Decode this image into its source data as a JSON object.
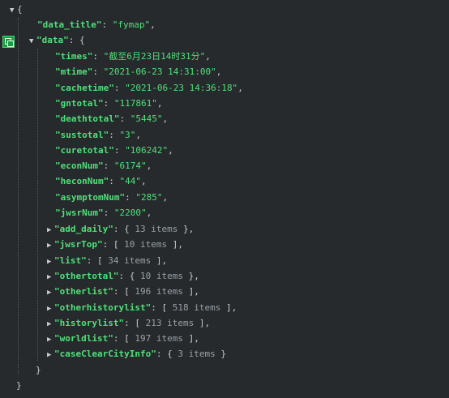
{
  "root": {
    "open": "{",
    "close": "}",
    "toggle": "▼"
  },
  "data_title": {
    "key": "\"data_title\"",
    "value": "\"fymap\""
  },
  "data_obj": {
    "key": "\"data\"",
    "open": "{",
    "close": "}",
    "toggle": "▼"
  },
  "fields": [
    {
      "key": "\"times\"",
      "value": "\"截至6月23日14时31分\""
    },
    {
      "key": "\"mtime\"",
      "value": "\"2021-06-23 14:31:00\""
    },
    {
      "key": "\"cachetime\"",
      "value": "\"2021-06-23 14:36:18\""
    },
    {
      "key": "\"gntotal\"",
      "value": "\"117861\""
    },
    {
      "key": "\"deathtotal\"",
      "value": "\"5445\""
    },
    {
      "key": "\"sustotal\"",
      "value": "\"3\""
    },
    {
      "key": "\"curetotal\"",
      "value": "\"106242\""
    },
    {
      "key": "\"econNum\"",
      "value": "\"6174\""
    },
    {
      "key": "\"heconNum\"",
      "value": "\"44\""
    },
    {
      "key": "\"asymptomNum\"",
      "value": "\"285\""
    },
    {
      "key": "\"jwsrNum\"",
      "value": "\"2200\""
    }
  ],
  "collapsed": [
    {
      "key": "\"add_daily\"",
      "open": "{",
      "count": "13 items",
      "close": "}",
      "toggle": "▶"
    },
    {
      "key": "\"jwsrTop\"",
      "open": "[",
      "count": "10 items",
      "close": "]",
      "toggle": "▶"
    },
    {
      "key": "\"list\"",
      "open": "[",
      "count": "34 items",
      "close": "]",
      "toggle": "▶"
    },
    {
      "key": "\"othertotal\"",
      "open": "{",
      "count": "10 items",
      "close": "}",
      "toggle": "▶"
    },
    {
      "key": "\"otherlist\"",
      "open": "[",
      "count": "196 items",
      "close": "]",
      "toggle": "▶"
    },
    {
      "key": "\"otherhistorylist\"",
      "open": "[",
      "count": "518 items",
      "close": "]",
      "toggle": "▶"
    },
    {
      "key": "\"historylist\"",
      "open": "[",
      "count": "213 items",
      "close": "]",
      "toggle": "▶"
    },
    {
      "key": "\"worldlist\"",
      "open": "[",
      "count": "197 items",
      "close": "]",
      "toggle": "▶"
    },
    {
      "key": "\"caseClearCityInfo\"",
      "open": "{",
      "count": "3 items",
      "close": "}",
      "toggle": "▶",
      "last": true
    }
  ],
  "colors": {
    "background": "#262a2c",
    "key": "#4fe07a",
    "copy_button": "#1f9a47"
  }
}
